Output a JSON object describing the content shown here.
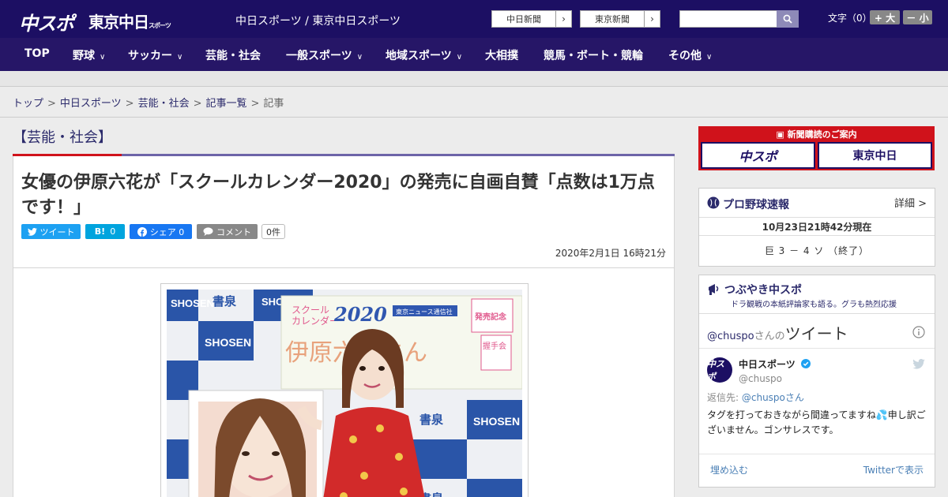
{
  "header": {
    "logo_chuspo": "中スポ",
    "logo_tokyo": "東京中日",
    "logo_tokyo_small": "スポーツ",
    "site_title": "中日スポーツ / 東京中日スポーツ",
    "paper_links": [
      "中日新聞",
      "東京新聞"
    ],
    "font_size_label": "文字（0）",
    "font_larger": "+ 大",
    "font_smaller": "－ 小"
  },
  "nav": {
    "items": [
      "TOP",
      "野球",
      "サッカー",
      "芸能・社会",
      "一般スポーツ",
      "地域スポーツ",
      "大相撲",
      "競馬・ボート・競輪",
      "その他"
    ]
  },
  "breadcrumb": {
    "items": [
      "トップ",
      "中日スポーツ",
      "芸能・社会",
      "記事一覧",
      "記事"
    ],
    "separator": ">"
  },
  "article": {
    "category": "【芸能・社会】",
    "headline": "女優の伊原六花が「スクールカレンダー2020」の発売に自画自賛「点数は1万点です！」",
    "share": {
      "tweet": "ツイート",
      "hatena_count": "0",
      "facebook": "シェア 0",
      "comment": "コメント",
      "comment_count": "0件"
    },
    "date": "2020年2月1日 16時21分"
  },
  "photo": {
    "brand_text": "SHOSEN",
    "brand_kanji": "書泉",
    "banner_title_line1": "スクール",
    "banner_title_line2": "カレンダー",
    "banner_year": "2020",
    "banner_publisher": "東京ニュース通信社",
    "banner_name": "伊原六花さん",
    "banner_release": "発売記念",
    "banner_event": "握手会"
  },
  "sidebar": {
    "promo_title": "新聞購読のご案内",
    "promo_logos": [
      "中スポ",
      "東京中日"
    ],
    "baseball": {
      "title": "プロ野球速報",
      "detail": "詳細 >",
      "date": "10月23日21時42分現在",
      "score": "巨 3 － 4 ソ （終了）"
    },
    "tweets": {
      "title": "つぶやき中スポ",
      "subtitle": "ドラ観戦の本紙評論家も語る。グラも熱烈応援",
      "handle_header": "@chuspo",
      "handle_header_suffix": "さんの",
      "header_big": "ツイート",
      "account_name": "中日スポーツ",
      "account_handle": "@chuspo",
      "reply_prefix": "返信先: ",
      "reply_to": "@chuspoさん",
      "text": "タグを打っておきながら間違ってますね💦申し訳ございません。ゴンサレスです。",
      "embed": "埋め込む",
      "view": "Twitterで表示"
    }
  },
  "colors": {
    "header_bg": "#1c0f63",
    "nav_bg": "#261667",
    "accent_red": "#d0121b",
    "link": "#2b2a6b",
    "twitter_blue": "#1da1f2",
    "hatena_blue": "#00a4de",
    "facebook_blue": "#1877f2"
  }
}
